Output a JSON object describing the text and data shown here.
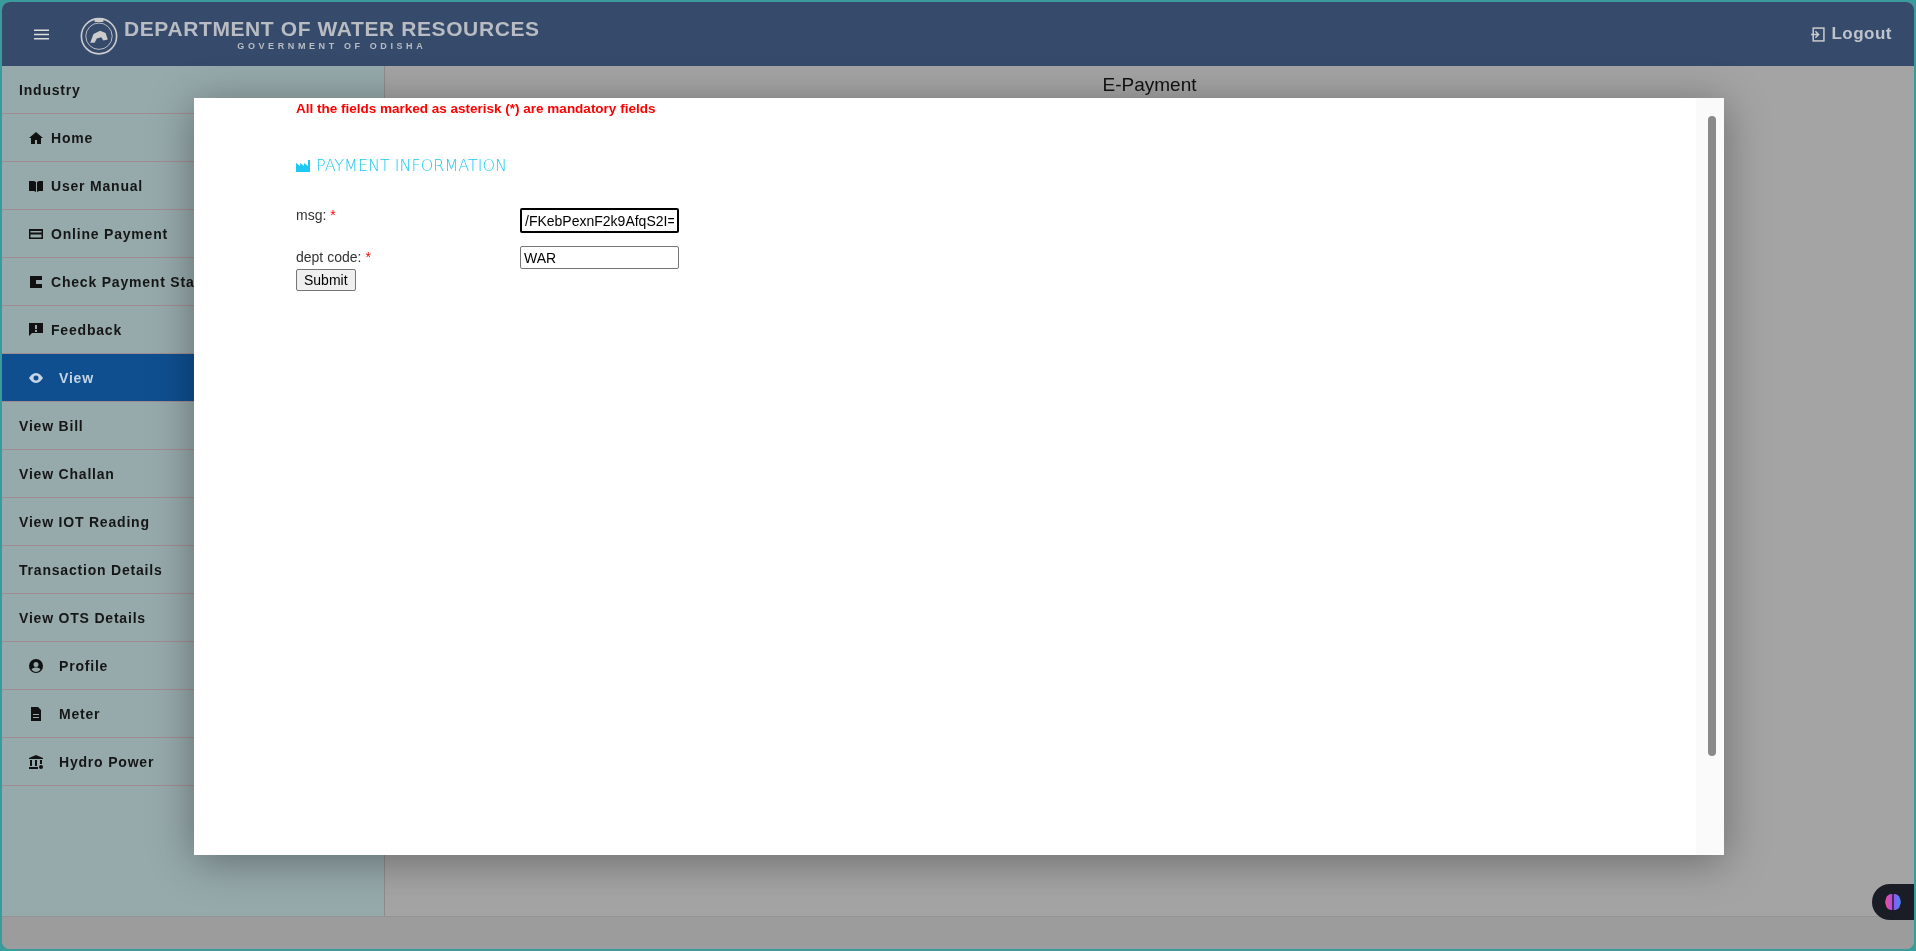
{
  "header": {
    "title": "DEPARTMENT OF WATER RESOURCES",
    "subtitle": "GOVERNMENT OF ODISHA",
    "logout": "Logout"
  },
  "sidebar": {
    "items": [
      {
        "label": "Industry",
        "kind": "group",
        "selected": false
      },
      {
        "label": "Home",
        "kind": "sub",
        "selected": false
      },
      {
        "label": "User Manual",
        "kind": "sub",
        "selected": false
      },
      {
        "label": "Online Payment",
        "kind": "sub",
        "selected": false
      },
      {
        "label": "Check Payment Sta",
        "kind": "sub",
        "selected": false
      },
      {
        "label": "Feedback",
        "kind": "sub",
        "selected": false
      },
      {
        "label": "View",
        "kind": "sub",
        "selected": true
      },
      {
        "label": "View Bill",
        "kind": "group",
        "selected": false
      },
      {
        "label": "View Challan",
        "kind": "group",
        "selected": false
      },
      {
        "label": "View IOT Reading",
        "kind": "group",
        "selected": false
      },
      {
        "label": "Transaction Details",
        "kind": "group",
        "selected": false
      },
      {
        "label": "View OTS Details",
        "kind": "group",
        "selected": false
      },
      {
        "label": "Profile",
        "kind": "sub",
        "selected": false
      },
      {
        "label": "Meter",
        "kind": "sub",
        "selected": false
      },
      {
        "label": "Hydro Power",
        "kind": "sub",
        "selected": false
      }
    ]
  },
  "page": {
    "title": "E-Payment"
  },
  "modal": {
    "notice": "All the fields marked as asterisk (*) are mandatory fields",
    "section": "PAYMENT INFORMATION",
    "fields": [
      {
        "label": "msg:",
        "required": "*",
        "value": "/FKebPexnF2k9AfqS2I=",
        "focused": true
      },
      {
        "label": "dept code:",
        "required": "*",
        "value": "WAR",
        "focused": false
      }
    ],
    "submit": "Submit"
  }
}
